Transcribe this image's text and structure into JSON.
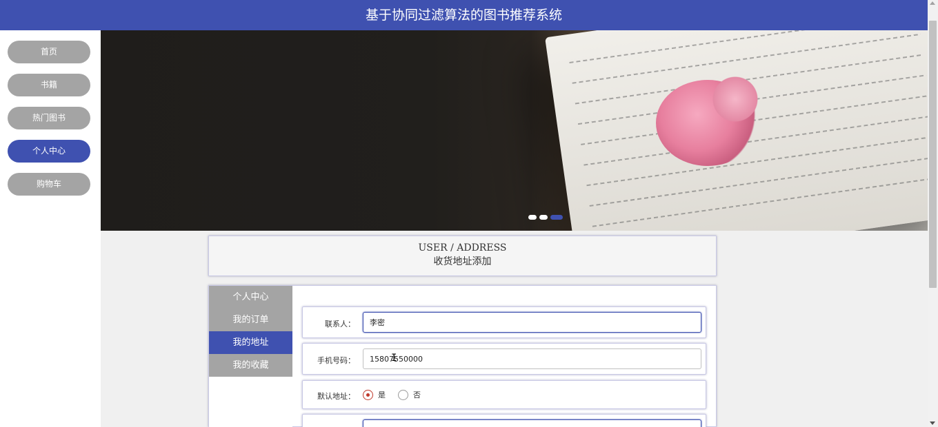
{
  "header": {
    "title": "基于协同过滤算法的图书推荐系统"
  },
  "leftnav": {
    "items": [
      {
        "label": "首页",
        "active": false
      },
      {
        "label": "书籍",
        "active": false
      },
      {
        "label": "热门图书",
        "active": false
      },
      {
        "label": "个人中心",
        "active": true
      },
      {
        "label": "购物车",
        "active": false
      }
    ]
  },
  "banner": {
    "active_slide": 3,
    "slide_count": 3
  },
  "page_title": {
    "en": "USER / ADDRESS",
    "cn": "收货地址添加"
  },
  "side_menu": {
    "items": [
      {
        "label": "个人中心",
        "active": false
      },
      {
        "label": "我的订单",
        "active": false
      },
      {
        "label": "我的地址",
        "active": true
      },
      {
        "label": "我的收藏",
        "active": false
      }
    ]
  },
  "form": {
    "contact": {
      "label": "联系人：",
      "value": "李密"
    },
    "phone": {
      "label": "手机号码：",
      "value": "15807550000"
    },
    "default": {
      "label": "默认地址：",
      "options": [
        "是",
        "否"
      ],
      "selected": "是"
    }
  },
  "colors": {
    "primary": "#3f51b0",
    "nav_inactive": "#a4a4a4",
    "radio_checked": "#c0392b"
  }
}
